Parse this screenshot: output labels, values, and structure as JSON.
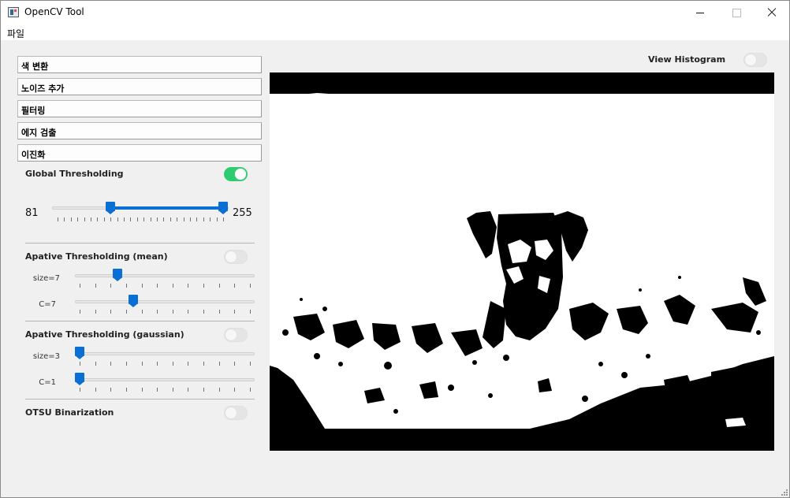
{
  "window": {
    "title": "OpenCV Tool"
  },
  "menu": {
    "file": "파일"
  },
  "sections": {
    "color_convert": "색 변환",
    "add_noise": "노이즈 추가",
    "filtering": "필터링",
    "edge_detect": "에지 검출",
    "binarization": "이진화"
  },
  "global": {
    "label": "Global Thresholding",
    "enabled": true,
    "low_value": "81",
    "high_value": "255",
    "low": 81,
    "high": 255,
    "range": [
      0,
      255
    ]
  },
  "adaptive_mean": {
    "label": "Apative Thresholding (mean)",
    "enabled": false,
    "size_label": "size=7",
    "c_label": "C=7",
    "size": 7,
    "c": 7
  },
  "adaptive_gaussian": {
    "label": "Apative Thresholding (gaussian)",
    "enabled": false,
    "size_label": "size=3",
    "c_label": "C=1",
    "size": 3,
    "c": 1
  },
  "otsu": {
    "label": "OTSU Binarization",
    "enabled": false
  },
  "view": {
    "histogram_label": "View Histogram",
    "histogram_enabled": false
  },
  "colors": {
    "accent": "#0a6fd4",
    "toggle_on": "#2ecc71"
  }
}
